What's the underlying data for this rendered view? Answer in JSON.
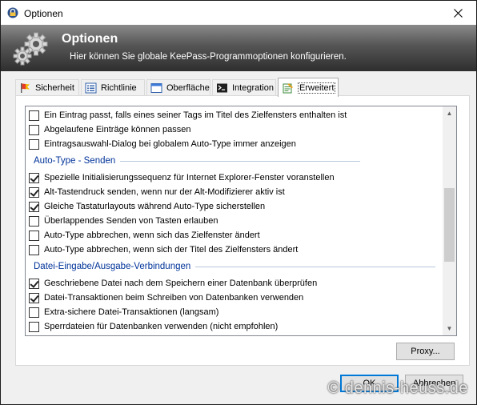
{
  "window": {
    "title": "Optionen",
    "app_icon": "keepass-lock-icon",
    "close_icon": "close-icon"
  },
  "banner": {
    "title": "Optionen",
    "subtitle": "Hier können Sie globale KeePass-Programmoptionen konfigurieren.",
    "icon": "gears-icon"
  },
  "tabs": [
    {
      "label": "Sicherheit",
      "icon": "flag-icon"
    },
    {
      "label": "Richtlinie",
      "icon": "list-icon"
    },
    {
      "label": "Oberfläche",
      "icon": "window-icon"
    },
    {
      "label": "Integration",
      "icon": "console-icon"
    },
    {
      "label": "Erweitert",
      "icon": "notepad-icon",
      "active": true
    }
  ],
  "options": {
    "top_items": [
      {
        "label": "Ein Eintrag passt, falls eines seiner Tags im Titel des Zielfensters enthalten ist",
        "checked": false
      },
      {
        "label": "Abgelaufene Einträge können passen",
        "checked": false
      },
      {
        "label": "Eintragsauswahl-Dialog bei globalem Auto-Type immer anzeigen",
        "checked": false
      }
    ],
    "group_autotype": {
      "title": "Auto-Type - Senden",
      "items": [
        {
          "label": "Spezielle Initialisierungssequenz für Internet Explorer-Fenster voranstellen",
          "checked": true
        },
        {
          "label": "Alt-Tastendruck senden, wenn nur der Alt-Modifizierer aktiv ist",
          "checked": true
        },
        {
          "label": "Gleiche Tastaturlayouts während Auto-Type sicherstellen",
          "checked": true
        },
        {
          "label": "Überlappendes Senden von Tasten erlauben",
          "checked": false
        },
        {
          "label": "Auto-Type abbrechen, wenn sich das Zielfenster ändert",
          "checked": false
        },
        {
          "label": "Auto-Type abbrechen, wenn sich der Titel des Zielfensters ändert",
          "checked": false
        }
      ]
    },
    "group_file": {
      "title": "Datei-Eingabe/Ausgabe-Verbindungen",
      "items": [
        {
          "label": "Geschriebene Datei nach dem Speichern einer Datenbank überprüfen",
          "checked": true
        },
        {
          "label": "Datei-Transaktionen beim Schreiben von Datenbanken verwenden",
          "checked": true
        },
        {
          "label": "Extra-sichere Datei-Transaktionen (langsam)",
          "checked": false
        },
        {
          "label": "Sperrdateien für Datenbanken verwenden (nicht empfohlen)",
          "checked": false
        }
      ]
    }
  },
  "buttons": {
    "proxy_label": "Proxy...",
    "ok_label": "OK",
    "cancel_label": "Abbrechen"
  },
  "watermark": "© dennis-heuss.de",
  "colors": {
    "group_title": "#003399",
    "accent": "#0078d7"
  }
}
